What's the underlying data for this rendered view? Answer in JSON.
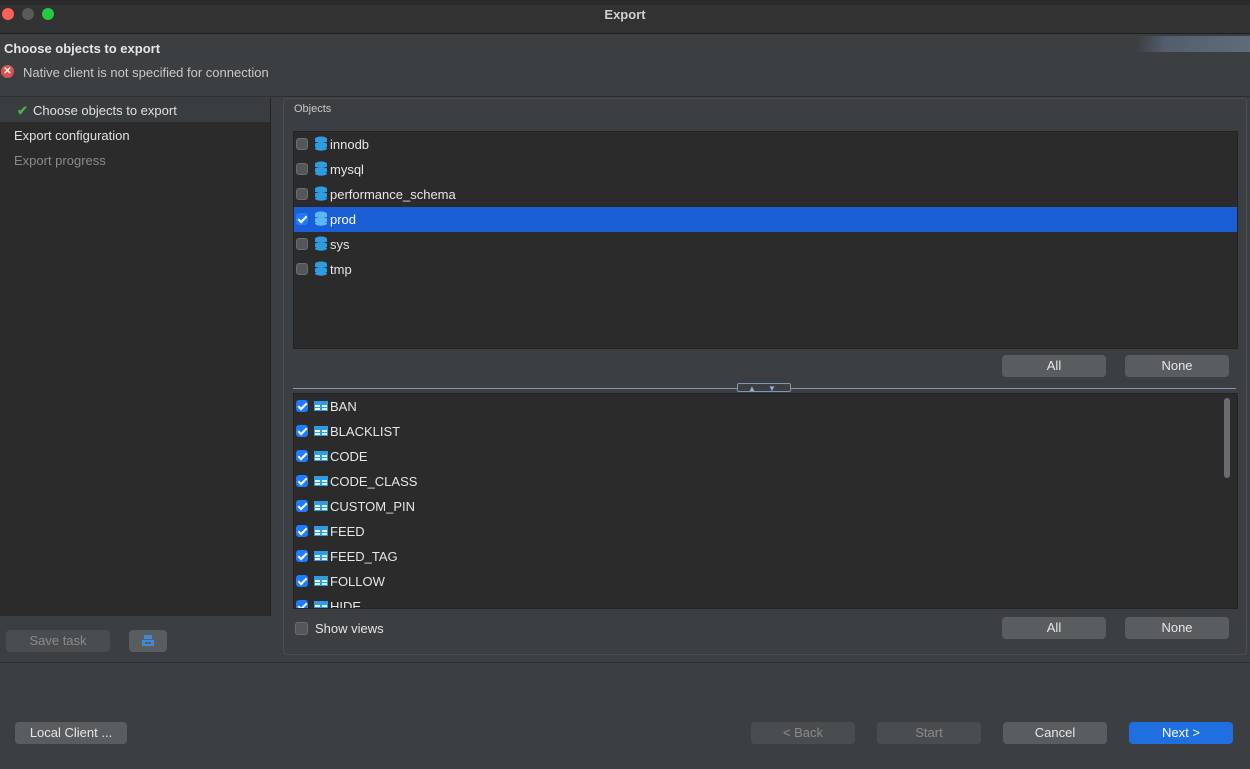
{
  "window": {
    "title": "Export"
  },
  "header": {
    "title": "Choose objects to export",
    "error_message": "Native client is not specified for connection",
    "error_icon": "error-icon"
  },
  "nav": {
    "items": [
      {
        "label": "Choose objects to export",
        "state": "done"
      },
      {
        "label": "Export configuration",
        "state": "normal"
      },
      {
        "label": "Export progress",
        "state": "disabled"
      }
    ],
    "save_task_label": "Save task",
    "task_icon": "task-icon"
  },
  "objects": {
    "group_label": "Objects",
    "schemas": [
      {
        "name": "innodb",
        "checked": false
      },
      {
        "name": "mysql",
        "checked": false
      },
      {
        "name": "performance_schema",
        "checked": false
      },
      {
        "name": "prod",
        "checked": true,
        "selected": true
      },
      {
        "name": "sys",
        "checked": false
      },
      {
        "name": "tmp",
        "checked": false
      }
    ],
    "tables": [
      {
        "name": "BAN",
        "checked": true
      },
      {
        "name": "BLACKLIST",
        "checked": true
      },
      {
        "name": "CODE",
        "checked": true
      },
      {
        "name": "CODE_CLASS",
        "checked": true
      },
      {
        "name": "CUSTOM_PIN",
        "checked": true
      },
      {
        "name": "FEED",
        "checked": true
      },
      {
        "name": "FEED_TAG",
        "checked": true
      },
      {
        "name": "FOLLOW",
        "checked": true
      },
      {
        "name": "HIDE",
        "checked": true
      }
    ],
    "all_label": "All",
    "none_label": "None",
    "show_views_label": "Show views"
  },
  "footer": {
    "local_client_label": "Local Client ...",
    "back_label": "< Back",
    "start_label": "Start",
    "cancel_label": "Cancel",
    "next_label": "Next >"
  },
  "colors": {
    "selection": "#1a5fd6",
    "primary_button": "#1f6fe0",
    "check_green": "#4caf50",
    "icon_blue": "#2f9be0"
  }
}
